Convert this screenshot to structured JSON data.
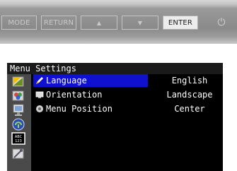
{
  "buttons": {
    "mode": "MODE",
    "return": "RETURN",
    "up": "▲",
    "down": "▼",
    "enter": "ENTER",
    "power": "⏻"
  },
  "menu": {
    "title": "Menu Settings",
    "highlight_color": "#1010d0",
    "sidebar_icons": [
      "brightness-icon",
      "color-icon",
      "screen-icon",
      "power-saver-icon",
      "menu-settings-icon",
      "tools-icon"
    ],
    "rows": [
      {
        "label": "Language",
        "value": "English",
        "icon": "pencil-icon",
        "selected": true
      },
      {
        "label": "Orientation",
        "value": "Landscape",
        "icon": "orientation-icon",
        "selected": false
      },
      {
        "label": "Menu Position",
        "value": "Center",
        "icon": "position-icon",
        "selected": false
      }
    ]
  }
}
